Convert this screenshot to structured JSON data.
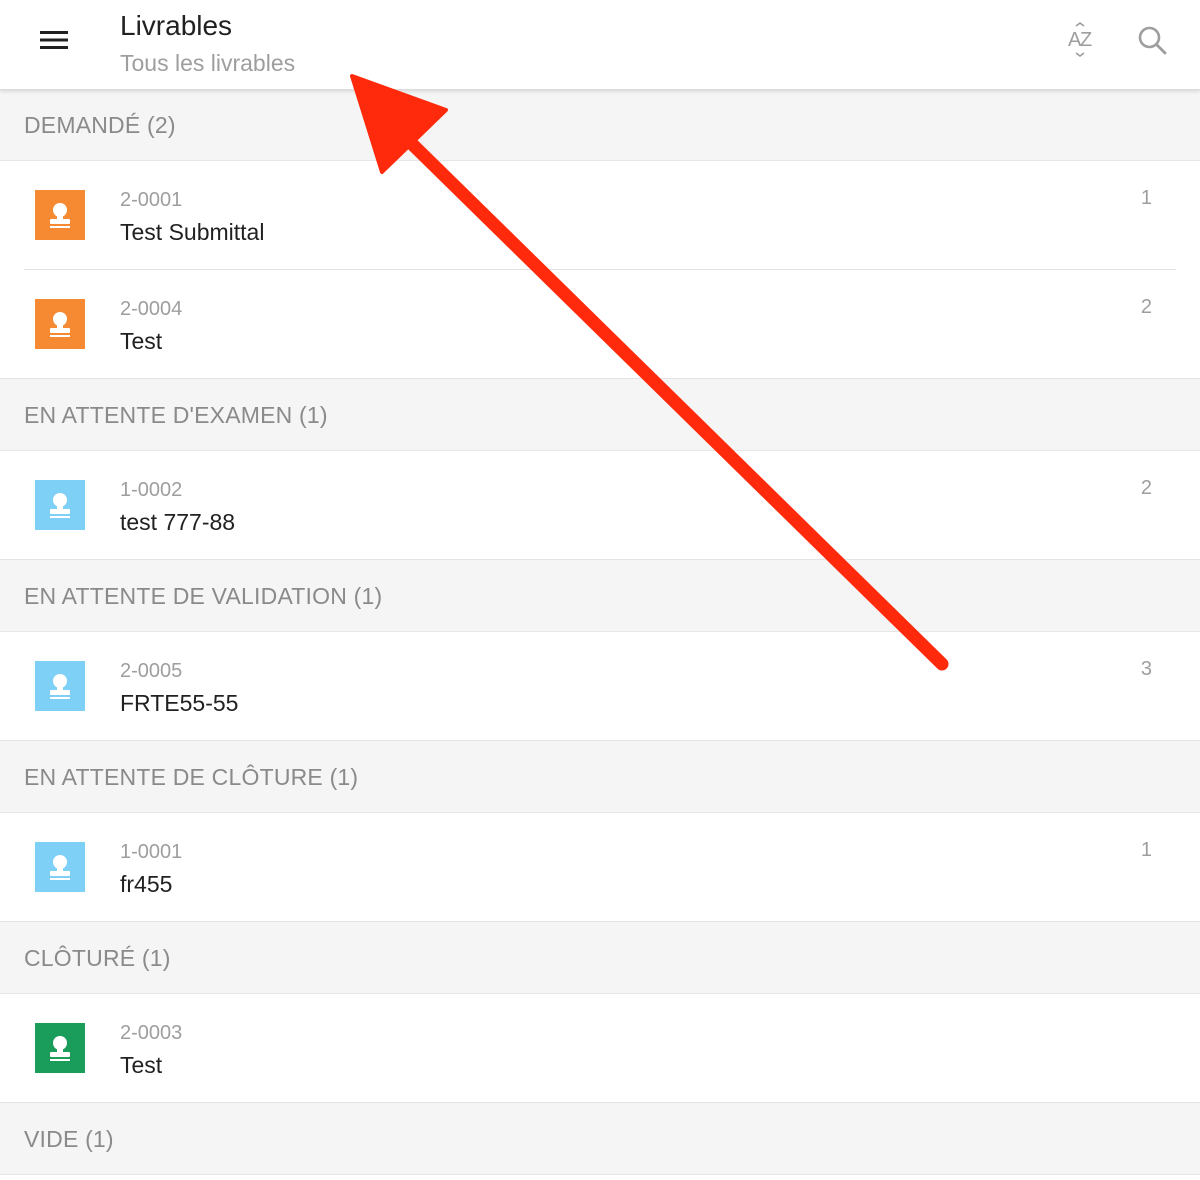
{
  "header": {
    "title": "Livrables",
    "subtitle": "Tous les livrables",
    "menu_icon": "hamburger-menu-icon",
    "sort_icon": "sort-alpha-icon",
    "sort_glyph_top": "A",
    "sort_glyph_bottom": "Z",
    "search_icon": "search-icon"
  },
  "colors": {
    "requested": "#f58a33",
    "pending": "#7fd0f7",
    "closed": "#1a9c5a",
    "annotation_arrow": "#ff2a0c"
  },
  "sections": [
    {
      "label": "DEMANDÉ (2)",
      "items": [
        {
          "id": "2-0001",
          "title": "Test Submittal",
          "count": "1",
          "status_color": "#f58a33"
        },
        {
          "id": "2-0004",
          "title": "Test",
          "count": "2",
          "status_color": "#f58a33"
        }
      ]
    },
    {
      "label": "EN ATTENTE D'EXAMEN (1)",
      "items": [
        {
          "id": "1-0002",
          "title": "test 777-88",
          "count": "2",
          "status_color": "#7fd0f7"
        }
      ]
    },
    {
      "label": "EN ATTENTE DE VALIDATION (1)",
      "items": [
        {
          "id": "2-0005",
          "title": "FRTE55-55",
          "count": "3",
          "status_color": "#7fd0f7"
        }
      ]
    },
    {
      "label": "EN ATTENTE DE CLÔTURE (1)",
      "items": [
        {
          "id": "1-0001",
          "title": "fr455",
          "count": "1",
          "status_color": "#7fd0f7"
        }
      ]
    },
    {
      "label": "CLÔTURÉ (1)",
      "items": [
        {
          "id": "2-0003",
          "title": "Test",
          "count": "",
          "status_color": "#1a9c5a"
        }
      ]
    },
    {
      "label": "VIDE (1)",
      "items": []
    }
  ]
}
